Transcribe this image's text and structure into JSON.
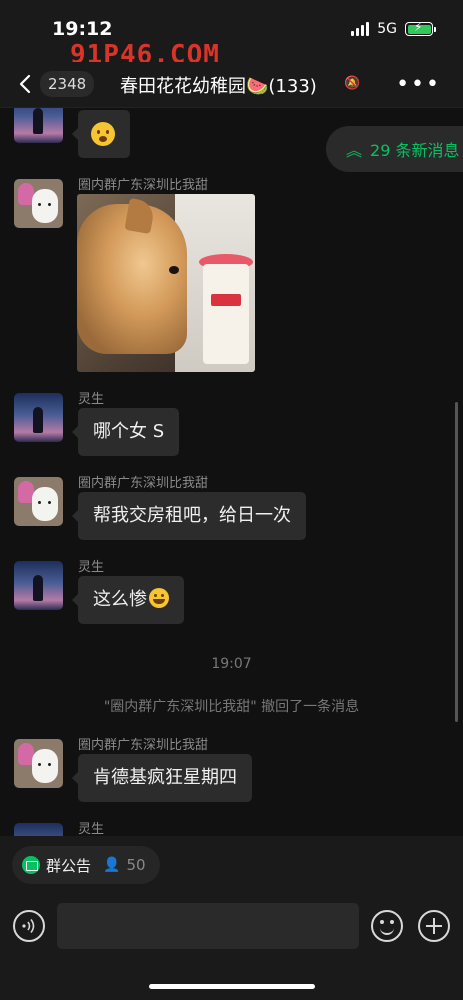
{
  "status_bar": {
    "time": "19:12",
    "network": "5G"
  },
  "watermark": "91P46.COM",
  "nav": {
    "unread_count": "2348",
    "title": "春田花花幼稚园🍉(133)",
    "more_label": "•••"
  },
  "new_messages_pill": {
    "label": "29 条新消息"
  },
  "messages": [
    {
      "sender": "",
      "type": "emoji"
    },
    {
      "sender": "圈内群广东深圳比我甜",
      "type": "image"
    },
    {
      "sender": "灵生",
      "text": "哪个女 S"
    },
    {
      "sender": "圈内群广东深圳比我甜",
      "text": "帮我交房租吧，给日一次"
    },
    {
      "sender": "灵生",
      "text": "这么惨"
    },
    {
      "sender": "圈内群广东深圳比我甜",
      "text": "肯德基疯狂星期四"
    },
    {
      "sender": "灵生",
      "type": "partial"
    }
  ],
  "timestamp": "19:07",
  "system_note": "\"圈内群广东深圳比我甜\" 撤回了一条消息",
  "announcement": {
    "label": "群公告",
    "member_count": "50"
  },
  "input": {
    "placeholder": ""
  },
  "colors": {
    "accent": "#07c160",
    "bubble": "#2c2c2c",
    "background": "#111111"
  }
}
